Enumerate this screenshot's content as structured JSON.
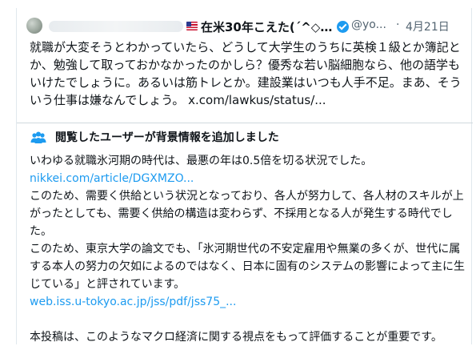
{
  "tweet": {
    "display_name": "在米30年こえた(´^◇^)...",
    "handle": "@yo...",
    "separator": "·",
    "time": "4月21日",
    "text": "就職が大変そうとわかっていたら、どうして大学生のうちに英検１級とか簿記とか、勉強して取っておかなかったのかしら？優秀な若い脳細胞なら、他の語学もいけたでしょうに。あるいは筋トレとか。建設業はいつも人手不足。まあ、そういう仕事は嫌なんでしょう。",
    "link": "x.com/lawkus/status/..."
  },
  "community_note": {
    "icon": "people-icon",
    "title": "閲覧したユーザーが背景情報を追加しました",
    "paragraph_1": "いわゆる就職氷河期の時代は、最悪の年は0.5倍を切る状況でした。",
    "link_1": "nikkei.com/article/DGXMZO...",
    "paragraph_2": "このため、需要く供給という状況となっており、各人が努力して、各人材のスキルが上がったとしても、需要く供給の構造は変わらず、不採用となる人が発生する時代でした。",
    "paragraph_3": "このため、東京大学の論文でも、「氷河期世代の不安定雇用や無業の多くが、世代に属する本人の努力の欠如によるのではなく、日本に固有のシステムの影響によって主に生じている」と評されています。",
    "link_2": "web.iss.u-tokyo.ac.jp/jss/pdf/jss75_...",
    "paragraph_4": "本投稿は、このようなマクロ経済に関する視点をもって評価することが重要です。"
  },
  "colors": {
    "accent": "#1d9bf0",
    "text": "#0f1419",
    "muted": "#536471",
    "border": "#cfd9de"
  }
}
